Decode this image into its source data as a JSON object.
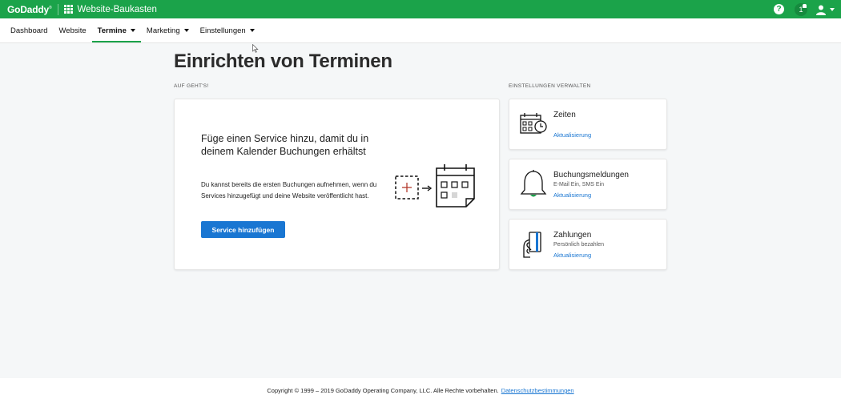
{
  "topbar": {
    "logo": "GoDaddy",
    "product": "Website-Baukasten",
    "help": "?",
    "notification_count": "1"
  },
  "nav": {
    "items": [
      {
        "label": "Dashboard"
      },
      {
        "label": "Website"
      },
      {
        "label": "Termine"
      },
      {
        "label": "Marketing"
      },
      {
        "label": "Einstellungen"
      }
    ]
  },
  "page": {
    "title": "Einrichten von Terminen",
    "left_label": "AUF GEHT'S!",
    "right_label": "EINSTELLUNGEN VERWALTEN"
  },
  "main_card": {
    "title": "Füge einen Service hinzu, damit du in deinem Kalender Buchungen erhältst",
    "description": "Du kannst bereits die ersten Buchungen aufnehmen, wenn du Services hinzugefügt und deine Website veröffentlicht hast.",
    "button": "Service hinzufügen"
  },
  "settings": [
    {
      "title": "Zeiten",
      "subtitle": "",
      "link": "Aktualisierung",
      "icon": "calendar-clock-icon"
    },
    {
      "title": "Buchungsmeldungen",
      "subtitle": "E-Mail Ein, SMS Ein",
      "link": "Aktualisierung",
      "icon": "bell-icon"
    },
    {
      "title": "Zahlungen",
      "subtitle": "Persönlich bezahlen",
      "link": "Aktualisierung",
      "icon": "card-hand-icon"
    }
  ],
  "footer": {
    "copyright": "Copyright © 1999 – 2019 GoDaddy Operating Company, LLC. Alle Rechte vorbehalten.",
    "privacy": "Datenschutzbestimmungen"
  },
  "colors": {
    "brand_green": "#1ba34a",
    "link_blue": "#1976d2"
  }
}
